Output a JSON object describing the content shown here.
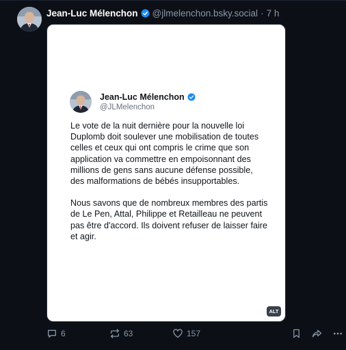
{
  "post": {
    "author_name": "Jean-Luc Mélenchon",
    "handle": "@jlmelenchon.bsky.social",
    "separator": "·",
    "time": "7 h"
  },
  "embedded_tweet": {
    "name": "Jean-Luc Mélenchon",
    "handle": "@JLMelenchon",
    "paragraphs": [
      "Le vote de la nuit dernière pour la nouvelle loi Duplomb doit soulever une mobilisation de toutes celles et ceux qui ont compris le crime que son application va commettre en empoisonnant des millions de gens sans aucune défense possible, des malformations de bébés insupportables.",
      "Nous savons que de nombreux membres des partis de Le Pen, Attal, Philippe et Retailleau ne peuvent pas être d'accord. Ils doivent refuser de laisser faire et agir."
    ],
    "alt_label": "ALT"
  },
  "actions": {
    "replies": "6",
    "reposts": "63",
    "likes": "157"
  },
  "colors": {
    "background": "#0c1016",
    "verified": "#1d8cf0",
    "muted": "#8a97a8"
  },
  "icons": [
    "verified-icon",
    "reply-icon",
    "repost-icon",
    "like-icon",
    "bookmark-icon",
    "share-icon",
    "more-icon"
  ]
}
